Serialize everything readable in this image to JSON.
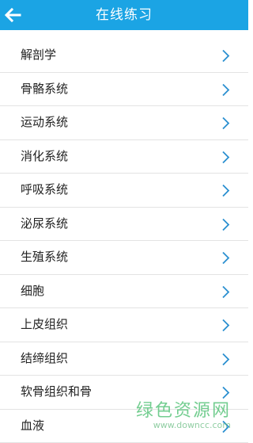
{
  "header": {
    "title": "在线练习",
    "back_icon": "arrow-left-icon",
    "background_color": "#1ba4e4"
  },
  "list": {
    "items": [
      {
        "label": "解剖学"
      },
      {
        "label": "骨骼系统"
      },
      {
        "label": "运动系统"
      },
      {
        "label": "消化系统"
      },
      {
        "label": "呼吸系统"
      },
      {
        "label": "泌尿系统"
      },
      {
        "label": "生殖系统"
      },
      {
        "label": "细胞"
      },
      {
        "label": "上皮组织"
      },
      {
        "label": "结缔组织"
      },
      {
        "label": "软骨组织和骨"
      },
      {
        "label": "血液"
      }
    ],
    "item_icon": "chevron-right-icon",
    "chevron_color": "#2a8fd0"
  },
  "watermark": {
    "main": "绿色资源网",
    "sub": "www.downcc.com"
  }
}
